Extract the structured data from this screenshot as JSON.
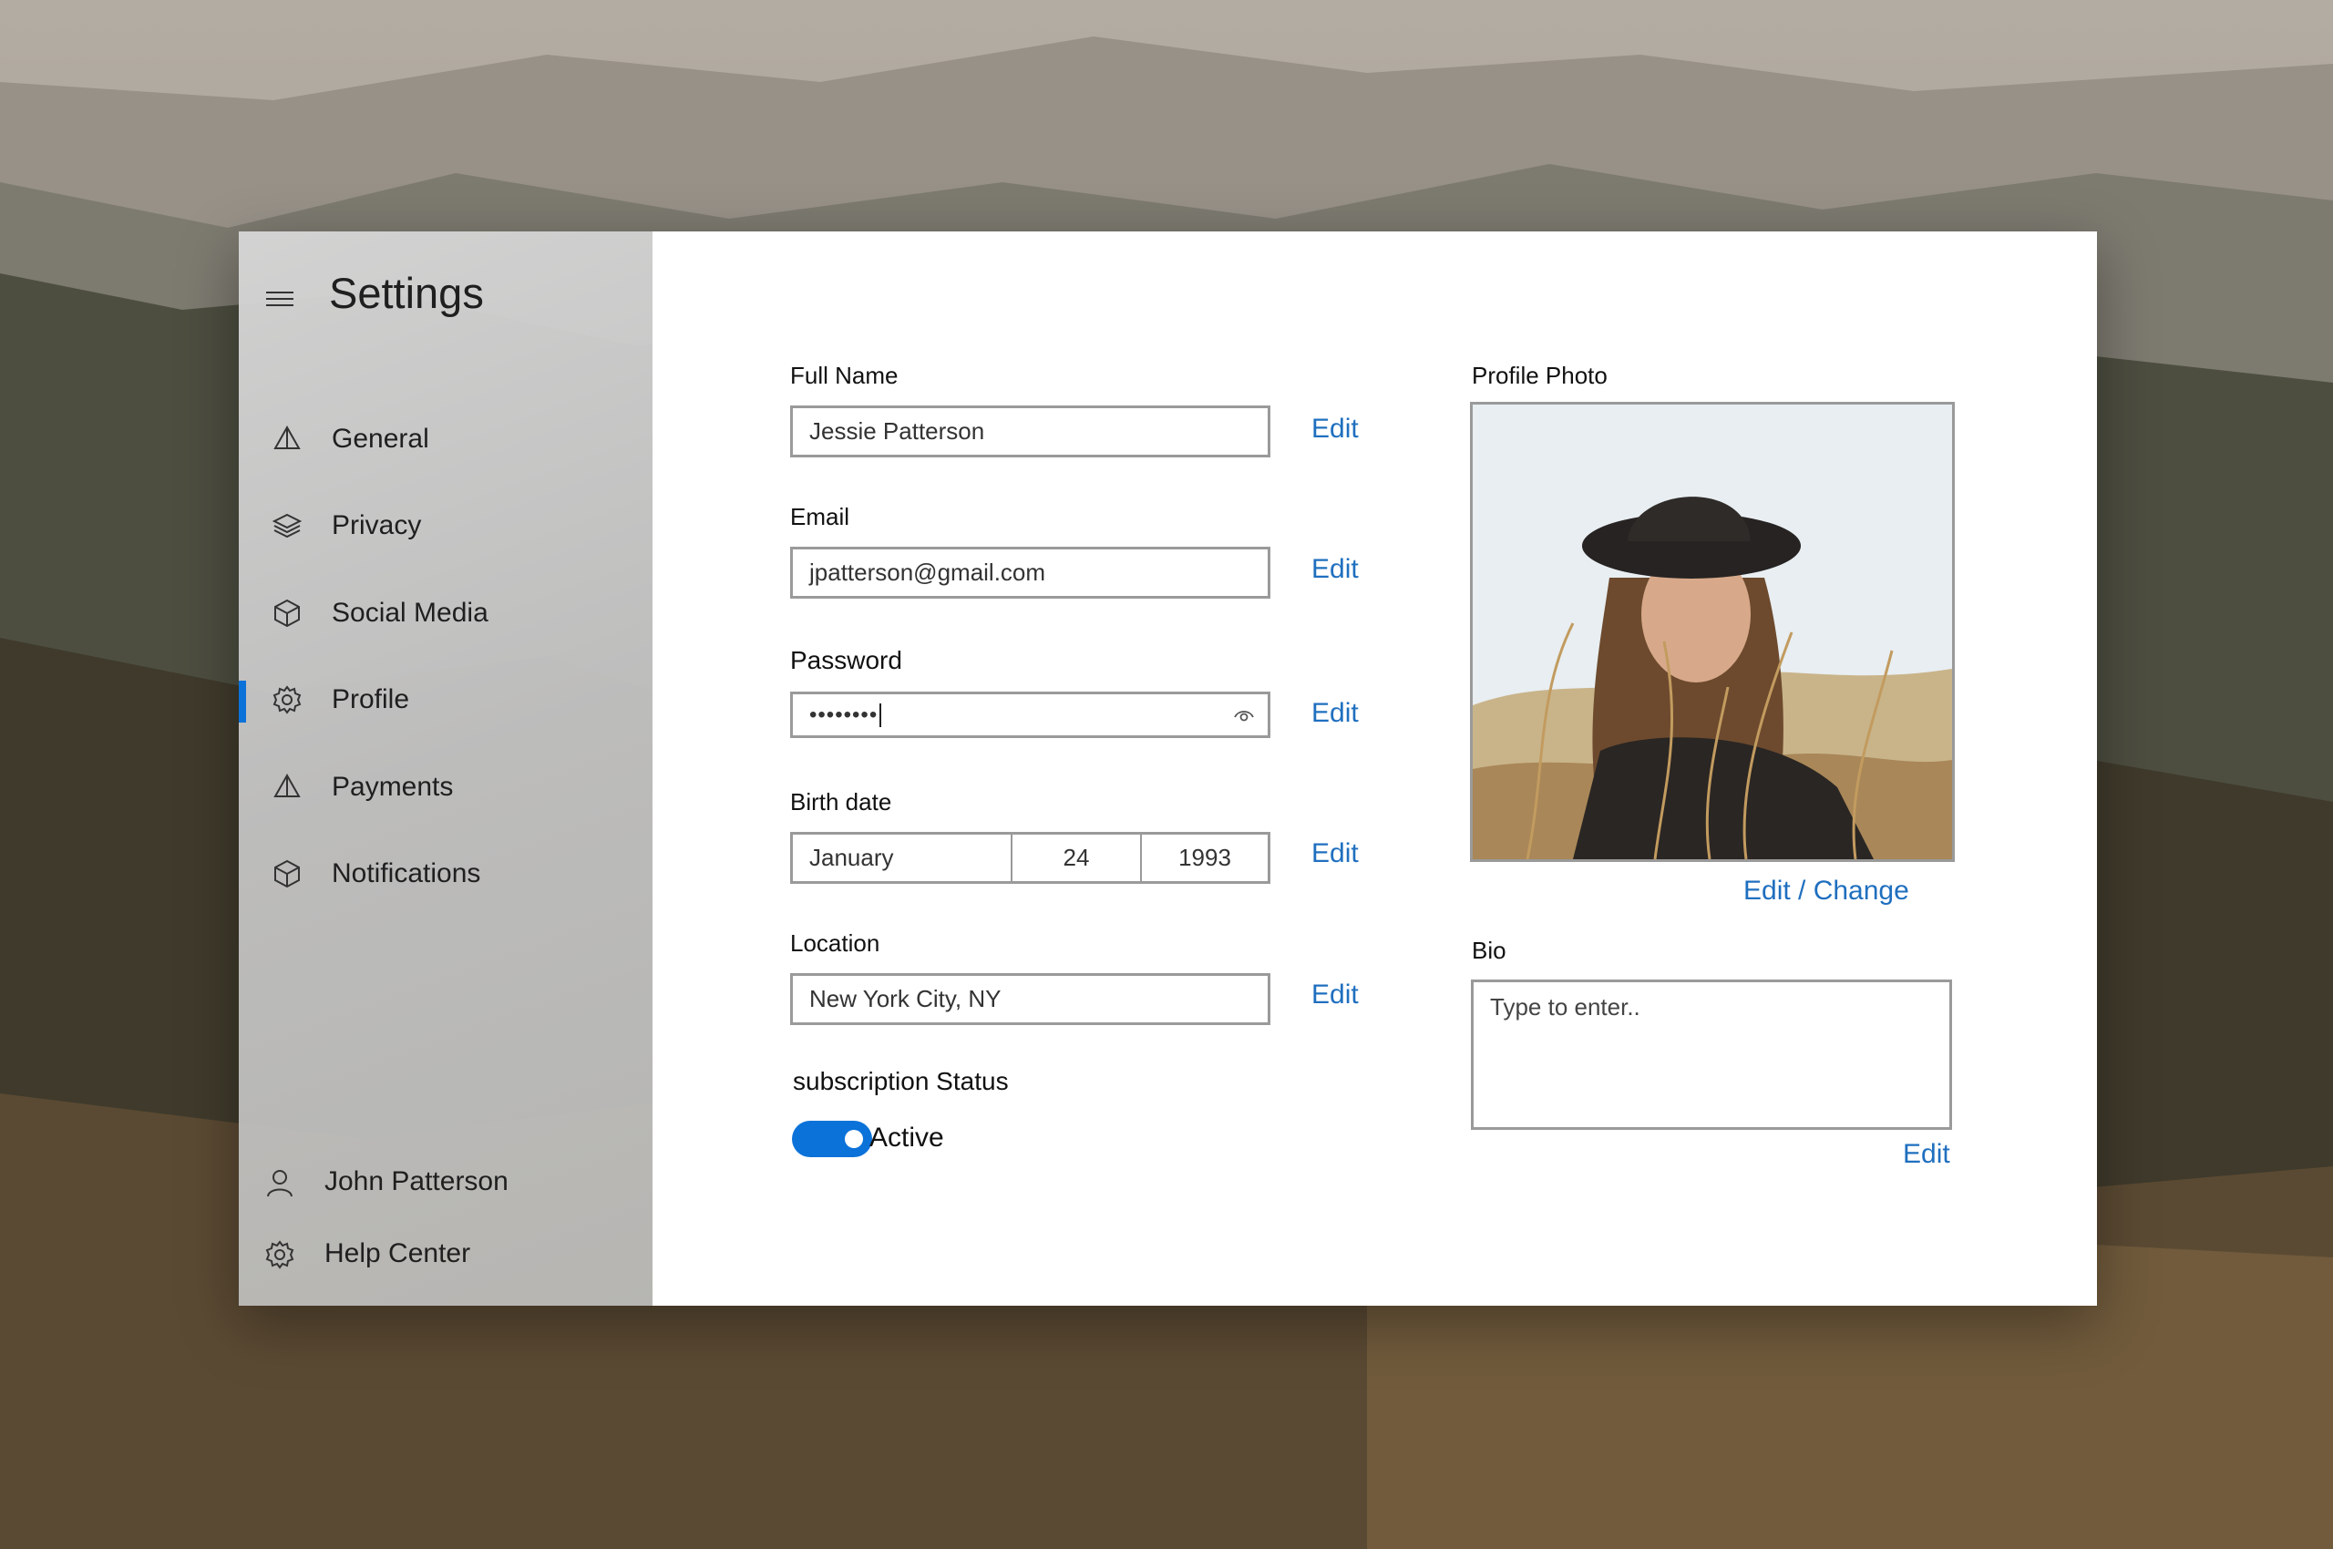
{
  "app": {
    "title": "Settings"
  },
  "sidebar": {
    "items": [
      {
        "label": "General",
        "icon": "pyramid-icon"
      },
      {
        "label": "Privacy",
        "icon": "layers-icon"
      },
      {
        "label": "Social Media",
        "icon": "cube-icon"
      },
      {
        "label": "Profile",
        "icon": "gear-icon",
        "selected": true
      },
      {
        "label": "Payments",
        "icon": "pyramid-icon"
      },
      {
        "label": "Notifications",
        "icon": "cube-icon"
      }
    ],
    "footer": [
      {
        "label": "John Patterson",
        "icon": "user-icon"
      },
      {
        "label": "Help Center",
        "icon": "gear-icon"
      }
    ]
  },
  "form": {
    "full_name": {
      "label": "Full Name",
      "value": "Jessie Patterson",
      "edit": "Edit"
    },
    "email": {
      "label": "Email",
      "value": "jpatterson@gmail.com",
      "edit": "Edit"
    },
    "password": {
      "label": "Password",
      "value": "••••••••",
      "edit": "Edit",
      "icon": "eye-icon"
    },
    "birth_date": {
      "label": "Birth date",
      "month": "January",
      "day": "24",
      "year": "1993",
      "edit": "Edit"
    },
    "location": {
      "label": "Location",
      "value": "New York City, NY",
      "edit": "Edit"
    },
    "subscription": {
      "label": "subscription Status",
      "state": "Active",
      "on": true
    }
  },
  "profile_photo": {
    "label": "Profile Photo",
    "edit": "Edit / Change"
  },
  "bio": {
    "label": "Bio",
    "placeholder": "Type to enter..",
    "edit": "Edit"
  },
  "colors": {
    "accent": "#0b72d9",
    "link": "#1f6fbf",
    "border": "#9a9a9a"
  }
}
